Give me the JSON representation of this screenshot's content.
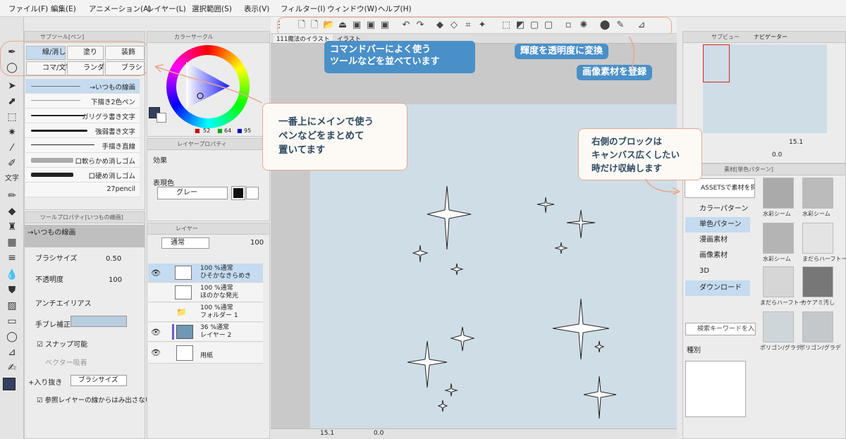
{
  "menubar": {
    "items": [
      "ファイル(F)",
      "編集(E)",
      "アニメーション(A)",
      "レイヤー(L)",
      "選択範囲(S)",
      "表示(V)",
      "フィルター(I)",
      "ウィンドウ(W)",
      "ヘルプ(H)"
    ]
  },
  "callouts": {
    "commandbar": "コマンドバーによく使う\nツールなどを並べています",
    "luminance": "輝度を透明度に変換",
    "register_material": "画像素材を登録",
    "main_pens": "一番上にメインで使う\nペンなどをまとめて\n置いてます",
    "right_block": "右側のブロックは\nキャンバス広くしたい\n時だけ収納します"
  },
  "subtool": {
    "tab_label": "サブツール[ペン]",
    "groups": [
      "線/消し",
      "塗り",
      "装飾",
      "コマ/文字",
      "ランダム",
      "ブラシ"
    ],
    "brushes": [
      "→いつもの線画",
      "下描き2色ペン",
      "ガリグラ書き文字",
      "強弱書き文字",
      "手描き直線",
      "口軟らかめ消しゴム",
      "口硬め消しゴム",
      "27pencil"
    ]
  },
  "color_circle": {
    "tab_label": "カラーサークル",
    "r": "52",
    "g": "64",
    "b": "95"
  },
  "layer_property": {
    "tab_label": "レイヤープロパティ",
    "effect_label": "効果",
    "expression_label": "表現色",
    "expression_value": "グレー"
  },
  "tool_property": {
    "tab_label": "ツールプロパティ[いつもの線画]",
    "preset": "→いつもの線画",
    "brush_size_label": "ブラシサイズ",
    "brush_size_value": "0.50",
    "opacity_label": "不透明度",
    "opacity_value": "100",
    "antialias_label": "アンチエイリアス",
    "stabilization_label": "手ブレ補正",
    "snap_label": "スナップ可能",
    "vector_snap_label": "ベクター吸着",
    "taper_label": "入り抜き",
    "taper_value": "ブラシサイズ",
    "ref_layer_label": "参照レイヤーの線からはみ出さない"
  },
  "layers": {
    "tab_label": "レイヤー",
    "blend_mode": "通常",
    "opacity": "100",
    "rows": [
      {
        "line1": "100 %通常",
        "line2": "ひそかなきらめき"
      },
      {
        "line1": "100 %通常",
        "line2": "ほのかな発光"
      },
      {
        "line1": "100 %通常",
        "line2": "フォルダー 1"
      },
      {
        "line1": "36 %通常",
        "line2": "レイヤー 2"
      },
      {
        "line1": "",
        "line2": "用紙"
      }
    ]
  },
  "canvas": {
    "tab1": "111魔法のイラスト",
    "tab2": "イラスト",
    "zoom": "15.1",
    "angle": "0.0"
  },
  "navigator": {
    "tab1": "サブビュー",
    "tab2": "ナビゲーター",
    "zoom": "15.1",
    "angle": "0.0"
  },
  "material": {
    "tab_label": "素材[単色パターン]",
    "assets_label": "ASSETSで素材を探",
    "tree": [
      "カラーパターン",
      "単色パターン",
      "漫画素材",
      "画像素材",
      "3D",
      "ダウンロード"
    ],
    "search_placeholder": "検索キーワードを入力",
    "kind_label": "種別",
    "thumbs": [
      "水彩シーム",
      "水彩シーム",
      "水彩シーム",
      "まだらハーフトー",
      "まだらハーフトー",
      "カケアミ汚し",
      "ポリゴン/グラデ",
      "ポリゴン/グラデ"
    ]
  },
  "colors": {
    "accent_blue": "#4a90c8",
    "callout_border": "#e8a78e",
    "paper": "#cfdde6",
    "main_color": "#344060",
    "selection": "#c5dbef"
  }
}
